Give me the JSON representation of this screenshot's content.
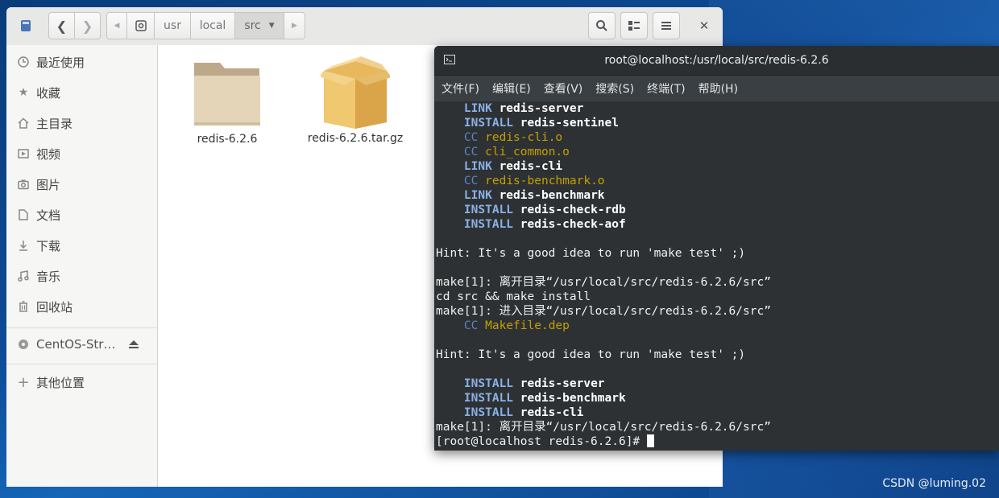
{
  "file_manager": {
    "path": [
      "usr",
      "local",
      "src"
    ],
    "sidebar": {
      "items": [
        {
          "label": "最近使用",
          "icon": "clock-icon"
        },
        {
          "label": "收藏",
          "icon": "star-icon"
        },
        {
          "label": "主目录",
          "icon": "home-icon"
        },
        {
          "label": "视频",
          "icon": "video-icon"
        },
        {
          "label": "图片",
          "icon": "camera-icon"
        },
        {
          "label": "文档",
          "icon": "document-icon"
        },
        {
          "label": "下载",
          "icon": "download-icon"
        },
        {
          "label": "音乐",
          "icon": "music-icon"
        },
        {
          "label": "回收站",
          "icon": "trash-icon"
        }
      ],
      "device": {
        "label": "CentOS-Str…",
        "icon": "disc-icon",
        "action_icon": "eject-icon"
      },
      "other": {
        "label": "其他位置",
        "icon": "plus-icon"
      }
    },
    "files": [
      {
        "name": "redis-6.2.6",
        "type": "folder"
      },
      {
        "name": "redis-6.2.6.tar.gz",
        "type": "archive"
      }
    ]
  },
  "terminal": {
    "title": "root@localhost:/usr/local/src/redis-6.2.6",
    "menu": [
      "文件(F)",
      "编辑(E)",
      "查看(V)",
      "搜索(S)",
      "终端(T)",
      "帮助(H)"
    ],
    "lines": {
      "l1": {
        "kw": "LINK",
        "target": "redis-server"
      },
      "l2": {
        "kw": "INSTALL",
        "target": "redis-sentinel"
      },
      "l3": {
        "kw": "CC",
        "target": "redis-cli.o"
      },
      "l4": {
        "kw": "CC",
        "target": "cli_common.o"
      },
      "l5": {
        "kw": "LINK",
        "target": "redis-cli"
      },
      "l6": {
        "kw": "CC",
        "target": "redis-benchmark.o"
      },
      "l7": {
        "kw": "LINK",
        "target": "redis-benchmark"
      },
      "l8": {
        "kw": "INSTALL",
        "target": "redis-check-rdb"
      },
      "l9": {
        "kw": "INSTALL",
        "target": "redis-check-aof"
      },
      "hint1": "Hint: It's a good idea to run 'make test' ;)",
      "make_leave1": "make[1]: 离开目录“/usr/local/src/redis-6.2.6/src”",
      "cd": "cd src && make install",
      "make_enter": "make[1]: 进入目录“/usr/local/src/redis-6.2.6/src”",
      "l10": {
        "kw": "CC",
        "target": "Makefile.dep"
      },
      "hint2": "Hint: It's a good idea to run 'make test' ;)",
      "l11": {
        "kw": "INSTALL",
        "target": "redis-server"
      },
      "l12": {
        "kw": "INSTALL",
        "target": "redis-benchmark"
      },
      "l13": {
        "kw": "INSTALL",
        "target": "redis-cli"
      },
      "make_leave2": "make[1]: 离开目录“/usr/local/src/redis-6.2.6/src”",
      "prompt": "[root@localhost redis-6.2.6]# "
    }
  },
  "watermark": "CSDN @luming.02"
}
